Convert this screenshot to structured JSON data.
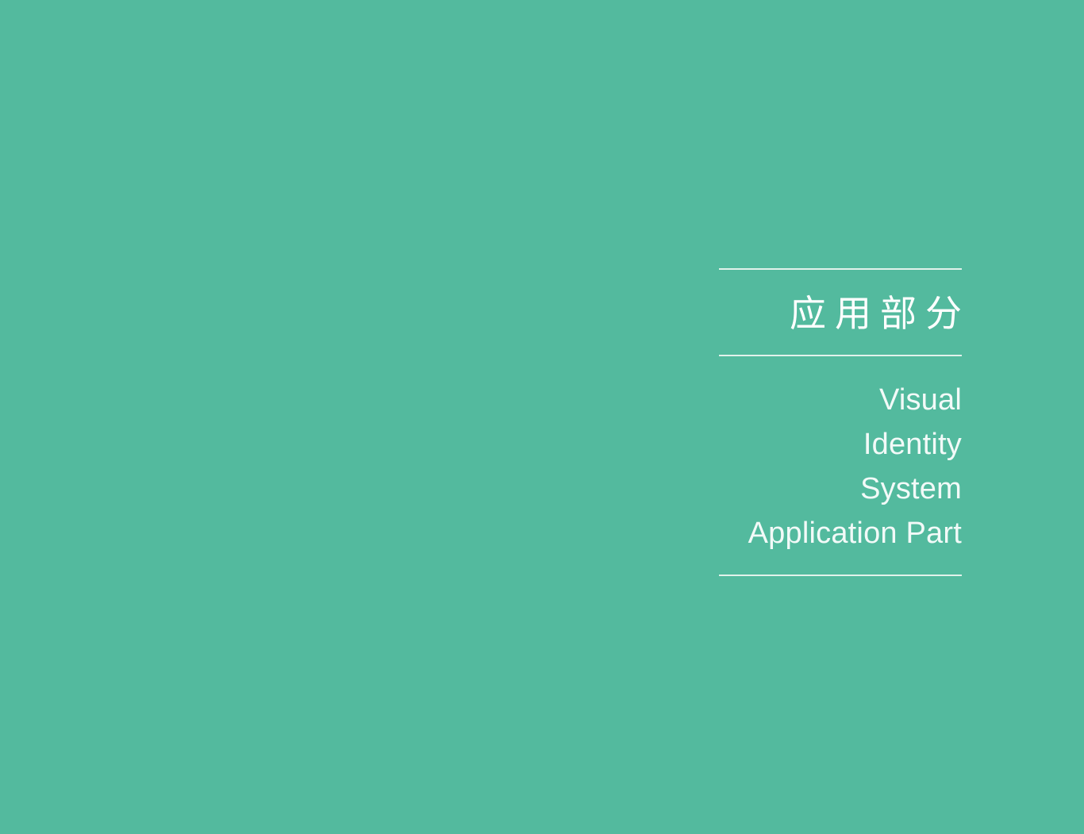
{
  "slide": {
    "background_color": "#53ba9e",
    "rule_color": "#eef6f2",
    "text_color": "#ffffff",
    "headline": "应用部分",
    "subtitle_lines": [
      "Visual",
      "Identity",
      "System",
      "Application Part"
    ]
  }
}
